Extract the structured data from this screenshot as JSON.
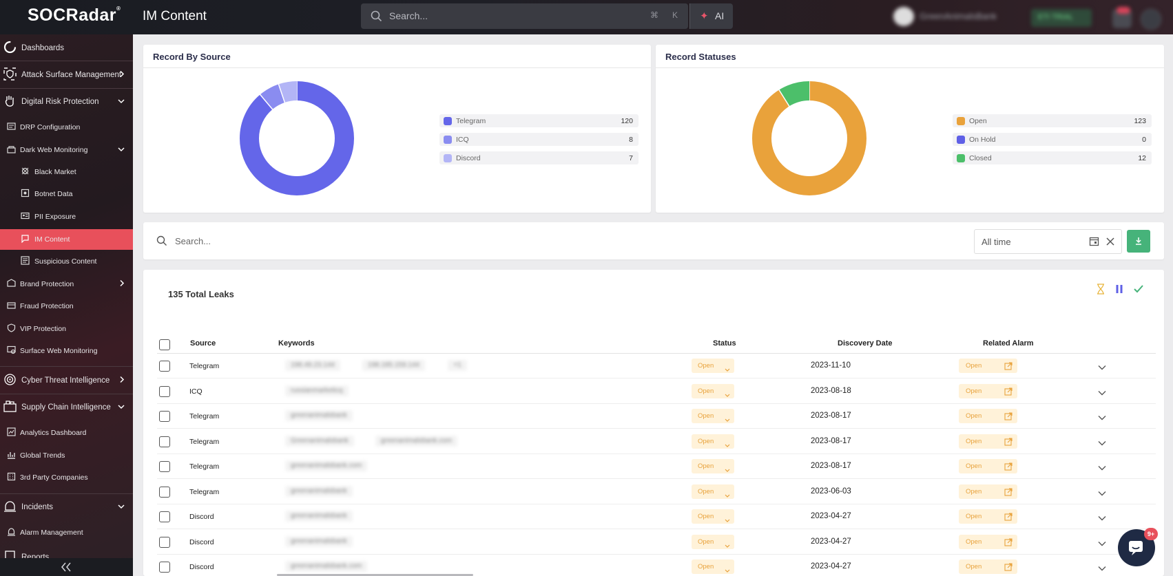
{
  "app": {
    "logo": "SOCRadar",
    "logo_mark": "®",
    "page_title": "IM Content"
  },
  "topbar": {
    "search_placeholder": "Search...",
    "shortcut_cmd": "⌘",
    "shortcut_key": "K",
    "ai_label": "AI",
    "tenant_name": "GreenAnimalsBank",
    "trial_label": "ETI TRIAL"
  },
  "sidebar": {
    "items": [
      {
        "label": "Dashboards"
      },
      {
        "label": "Attack Surface Management"
      },
      {
        "label": "Digital Risk Protection"
      },
      {
        "label": "DRP Configuration"
      },
      {
        "label": "Dark Web Monitoring"
      },
      {
        "label": "Black Market"
      },
      {
        "label": "Botnet Data"
      },
      {
        "label": "PII Exposure"
      },
      {
        "label": "IM Content"
      },
      {
        "label": "Suspicious Content"
      },
      {
        "label": "Brand Protection"
      },
      {
        "label": "Fraud Protection"
      },
      {
        "label": "VIP Protection"
      },
      {
        "label": "Surface Web Monitoring"
      },
      {
        "label": "Cyber Threat Intelligence"
      },
      {
        "label": "Supply Chain Intelligence"
      },
      {
        "label": "Analytics Dashboard"
      },
      {
        "label": "Global Trends"
      },
      {
        "label": "3rd Party Companies"
      },
      {
        "label": "Incidents"
      },
      {
        "label": "Alarm Management"
      },
      {
        "label": "Reports"
      }
    ]
  },
  "record_by_source": {
    "title": "Record By Source",
    "legend": [
      {
        "name": "Telegram",
        "value": "120",
        "color": "#6466e9"
      },
      {
        "name": "ICQ",
        "value": "8",
        "color": "#8a8cf0"
      },
      {
        "name": "Discord",
        "value": "7",
        "color": "#b3b5f6"
      }
    ]
  },
  "record_statuses": {
    "title": "Record Statuses",
    "legend": [
      {
        "name": "Open",
        "value": "123",
        "color": "#e9a23b"
      },
      {
        "name": "On Hold",
        "value": "0",
        "color": "#5f60e6"
      },
      {
        "name": "Closed",
        "value": "12",
        "color": "#4cbf6a"
      }
    ]
  },
  "filter": {
    "search_placeholder": "Search...",
    "date_value": "All time"
  },
  "table": {
    "total_label": "135 Total Leaks",
    "headers": {
      "source": "Source",
      "keywords": "Keywords",
      "status": "Status",
      "discovery_date": "Discovery Date",
      "related_alarm": "Related Alarm"
    },
    "rows": [
      {
        "source": "Telegram",
        "keywords": [
          "198.49.23.144",
          "198.185.159.144",
          "+1"
        ],
        "status": "Open",
        "date": "2023-11-10",
        "alarm": "Open"
      },
      {
        "source": "ICQ",
        "keywords": [
          "russianmarketicq"
        ],
        "status": "Open",
        "date": "2023-08-18",
        "alarm": "Open"
      },
      {
        "source": "Telegram",
        "keywords": [
          "greenanimalsbank"
        ],
        "status": "Open",
        "date": "2023-08-17",
        "alarm": "Open"
      },
      {
        "source": "Telegram",
        "keywords": [
          "Greenanimalsbank",
          "greenanimalsbank.com"
        ],
        "status": "Open",
        "date": "2023-08-17",
        "alarm": "Open"
      },
      {
        "source": "Telegram",
        "keywords": [
          "greenanimalsbank.com"
        ],
        "status": "Open",
        "date": "2023-08-17",
        "alarm": "Open"
      },
      {
        "source": "Telegram",
        "keywords": [
          "greenanimalsbank"
        ],
        "status": "Open",
        "date": "2023-06-03",
        "alarm": "Open"
      },
      {
        "source": "Discord",
        "keywords": [
          "greenanimalsbank"
        ],
        "status": "Open",
        "date": "2023-04-27",
        "alarm": "Open"
      },
      {
        "source": "Discord",
        "keywords": [
          "greenanimalsbank"
        ],
        "status": "Open",
        "date": "2023-04-27",
        "alarm": "Open"
      },
      {
        "source": "Discord",
        "keywords": [
          "greenanimalsbank.com"
        ],
        "status": "Open",
        "date": "2023-04-27",
        "alarm": "Open"
      }
    ]
  },
  "help": {
    "badge": "9+"
  },
  "colors": {
    "accent_red": "#e8505b",
    "open_orange": "#e8a23c",
    "download_green": "#46b37a"
  }
}
